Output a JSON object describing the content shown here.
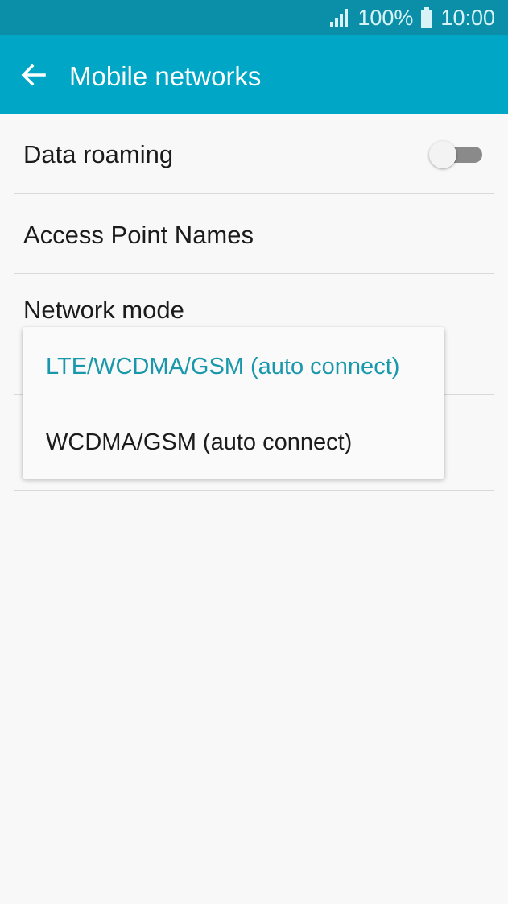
{
  "status_bar": {
    "battery": "100%",
    "time": "10:00",
    "icons": {
      "signal": "signal-icon",
      "battery": "battery-icon"
    }
  },
  "app_bar": {
    "title": "Mobile networks",
    "back_icon": "back-arrow-icon"
  },
  "settings": {
    "items": [
      {
        "label": "Data roaming",
        "toggle_on": false
      },
      {
        "label": "Access Point Names"
      },
      {
        "label": "Network mode"
      }
    ]
  },
  "network_mode_dropdown": {
    "options": [
      {
        "label": "LTE/WCDMA/GSM (auto connect)",
        "selected": true
      },
      {
        "label": "WCDMA/GSM (auto connect)",
        "selected": false
      }
    ]
  },
  "colors": {
    "status_bar": "#0b8ea8",
    "app_bar": "#00a6c6",
    "selected_option": "#1998ac",
    "background": "#f8f8f8"
  }
}
